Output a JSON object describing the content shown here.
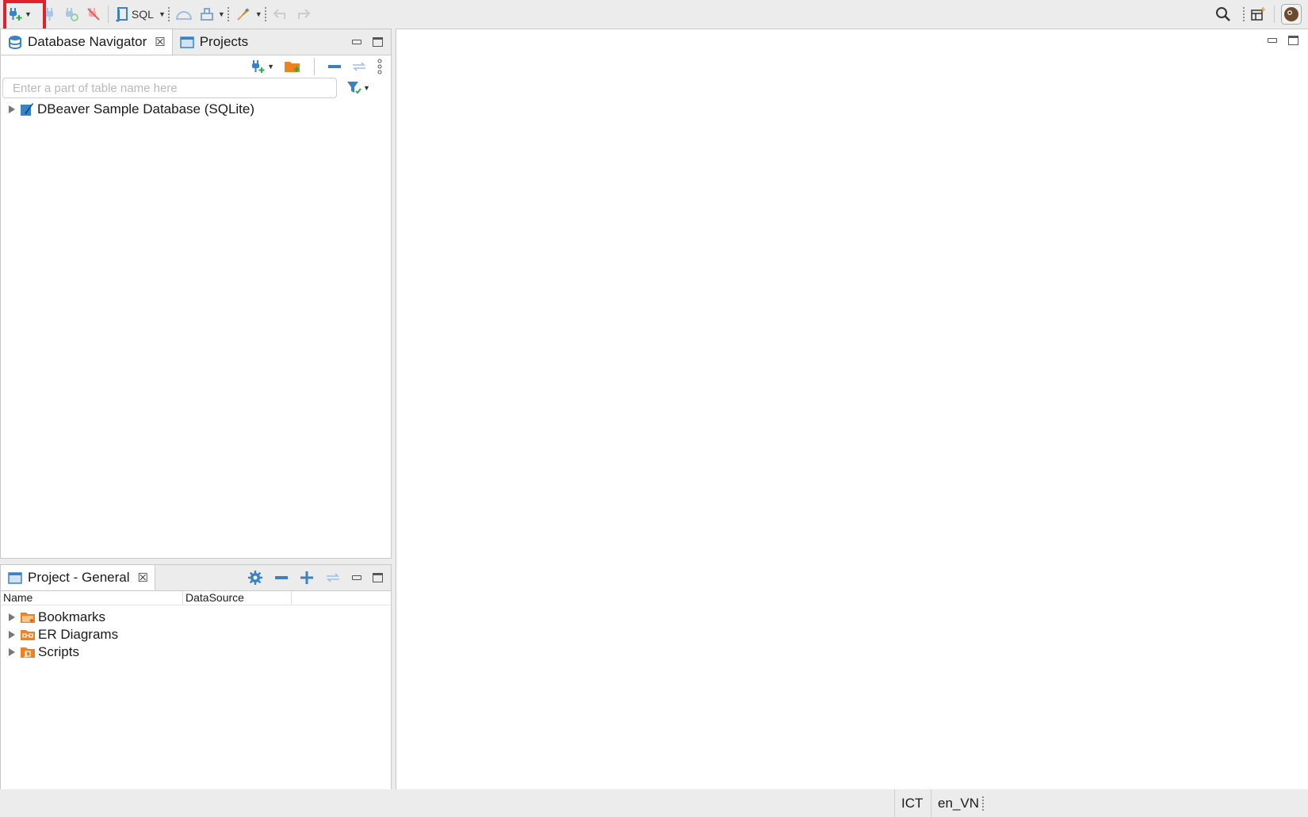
{
  "toolbar": {
    "sql_label": "SQL",
    "icons": [
      "new-connection-icon",
      "connect-icon",
      "reconnect-icon",
      "disconnect-icon",
      "sql-editor-icon",
      "transaction-icon",
      "commit-icon",
      "tools-icon",
      "back-icon",
      "forward-icon",
      "search-icon",
      "perspective-icon",
      "avatar"
    ]
  },
  "navigator": {
    "tab_label": "Database Navigator",
    "projects_tab_label": "Projects",
    "search_placeholder": "Enter a part of table name here",
    "tree": [
      {
        "label": "DBeaver Sample Database (SQLite)"
      }
    ]
  },
  "project_panel": {
    "tab_label": "Project - General",
    "columns": [
      "Name",
      "DataSource"
    ],
    "items": [
      {
        "label": "Bookmarks"
      },
      {
        "label": "ER Diagrams"
      },
      {
        "label": "Scripts"
      }
    ]
  },
  "status": {
    "timezone": "ICT",
    "locale": "en_VN"
  },
  "colors": {
    "accent": "#3b82c4",
    "folder": "#f0821e",
    "highlight": "#e2202c"
  }
}
